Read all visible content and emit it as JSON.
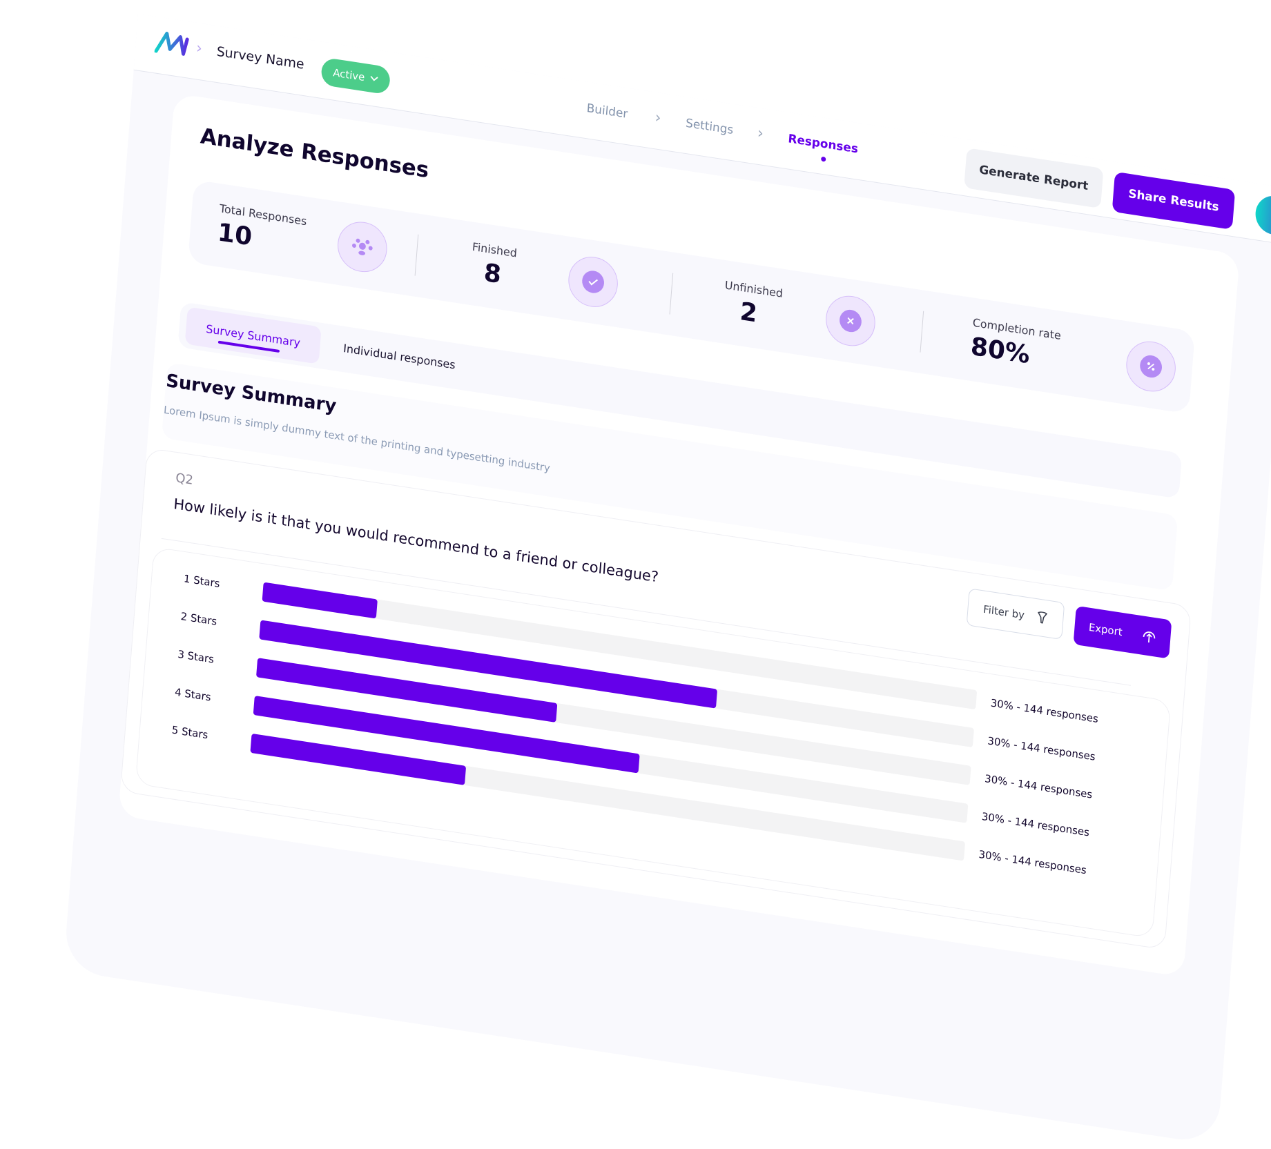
{
  "header": {
    "survey_name": "Survey Name",
    "status": "Active",
    "nav": [
      "Builder",
      "Settings",
      "Responses"
    ],
    "active_nav": "Responses",
    "generate_report": "Generate Report",
    "share_results": "Share Results"
  },
  "page": {
    "title": "Analyze Responses",
    "stats": [
      {
        "label": "Total Responses",
        "value": "10",
        "icon": "people-icon"
      },
      {
        "label": "Finished",
        "value": "8",
        "icon": "check-icon"
      },
      {
        "label": "Unfinished",
        "value": "2",
        "icon": "x-icon"
      },
      {
        "label": "Completion rate",
        "value": "80%",
        "icon": "percent-icon"
      }
    ],
    "tabs": [
      "Survey Summary",
      "Individual responses"
    ],
    "summary_title": "Survey Summary",
    "summary_subtitle": "Lorem Ipsum is simply dummy text of the printing and typesetting industry"
  },
  "question": {
    "number": "Q2",
    "text": "How likely is it that you would recommend to a friend or colleague?",
    "filter_label": "Filter by",
    "export_label": "Export"
  },
  "colors": {
    "accent": "#6500ea",
    "active_green": "#4ccd8a",
    "track": "#f3f3f4"
  },
  "chart_data": {
    "type": "bar",
    "orientation": "horizontal",
    "categories": [
      "1 Stars",
      "2 Stars",
      "3 Stars",
      "4 Stars",
      "5 Stars"
    ],
    "values": [
      16,
      64,
      42,
      54,
      30
    ],
    "value_labels": [
      "30% - 144 responses",
      "30% - 144 responses",
      "30% - 144 responses",
      "30% - 144 responses",
      "30% - 144 responses"
    ],
    "xlim": [
      0,
      100
    ]
  }
}
